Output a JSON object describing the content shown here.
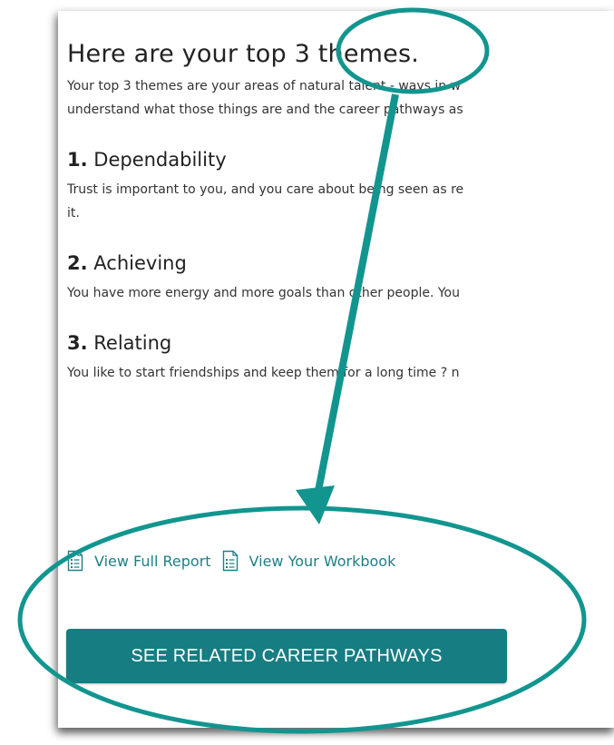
{
  "page": {
    "title": "Here are your top 3 themes.",
    "intro_line1": "Your top 3 themes are your areas of natural talent - ways in w",
    "intro_line2": "understand what those things are and the career pathways as"
  },
  "themes": [
    {
      "number": "1.",
      "name": "Dependability",
      "desc_line1": "Trust is important to you, and you care about being seen as re",
      "desc_line2": "it."
    },
    {
      "number": "2.",
      "name": "Achieving",
      "desc_line1": "You have more energy and more goals than other people. You"
    },
    {
      "number": "3.",
      "name": "Relating",
      "desc_line1": "You like to start friendships and keep them for a long time ? n"
    }
  ],
  "links": {
    "full_report": "View Full Report",
    "workbook": "View Your Workbook"
  },
  "cta": {
    "label": "SEE RELATED CAREER PATHWAYS"
  },
  "icons": {
    "report": "document-list-icon",
    "workbook": "document-list-icon"
  },
  "colors": {
    "accent": "#167d82",
    "link": "#1d7f86",
    "annotation": "#12958f"
  }
}
